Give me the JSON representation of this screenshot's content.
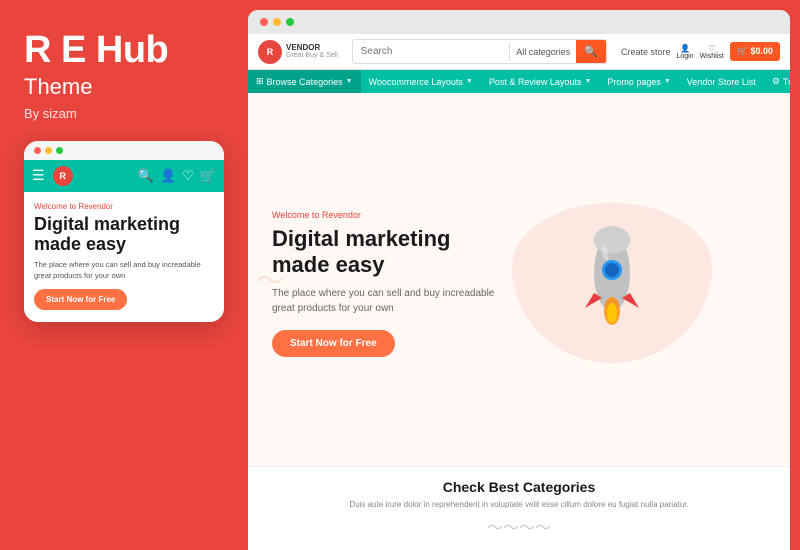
{
  "left": {
    "title": "R E Hub",
    "subtitle": "Theme",
    "author": "By sizam"
  },
  "mobile": {
    "welcome": "Welcome to Revendor",
    "headline": "Digital marketing made easy",
    "description": "The place where you can sell and buy increadable great products for your own",
    "cta_button": "Start Now for Free",
    "logo_letter": "R",
    "dots": [
      "●",
      "●",
      "●"
    ]
  },
  "browser": {
    "vendor_logo": "R",
    "vendor_name": "VENDOR",
    "vendor_tagline": "Great Buy & Sell",
    "search_placeholder": "Search",
    "categories_label": "All categories",
    "create_store": "Create store",
    "login_label": "Login",
    "wishlist_label": "Wishlist",
    "cart_price": "$0.00",
    "nav_items": [
      {
        "label": "Browse Categories",
        "has_chevron": true,
        "highlight": true
      },
      {
        "label": "Woocommerce Layouts",
        "has_chevron": true
      },
      {
        "label": "Post & Review Layouts",
        "has_chevron": true
      },
      {
        "label": "Promo pages",
        "has_chevron": true
      },
      {
        "label": "Vendor Store List"
      },
      {
        "label": "Tutorials",
        "has_icon": true
      }
    ],
    "hero": {
      "welcome": "Welcome to Revendor",
      "headline_line1": "Digital marketing",
      "headline_line2": "made easy",
      "description": "The place where you can sell and buy increadable great products for your own",
      "cta_button": "Start Now for Free"
    },
    "categories": {
      "title": "Check Best Categories",
      "description": "Duis aute irure dolor in reprehenderit in voluptate velit esse cillum dolore eu fugiat nulla pariatur."
    }
  }
}
